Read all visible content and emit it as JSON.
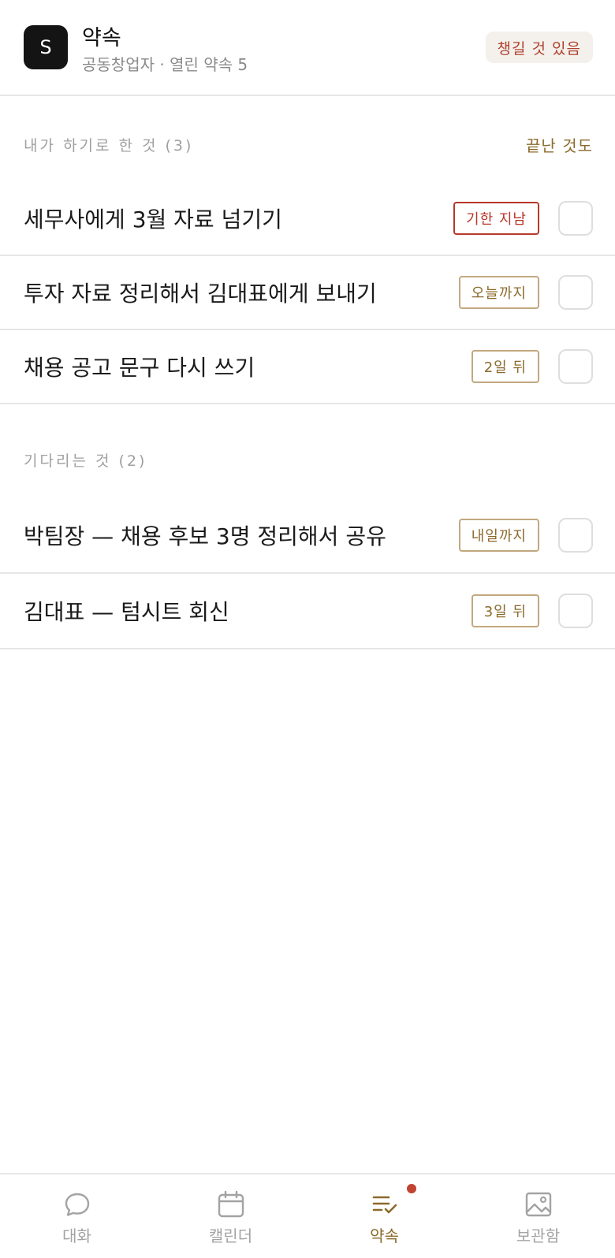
{
  "header": {
    "avatar_letter": "S",
    "title": "약속",
    "subtitle": "공동창업자 · 열린 약속 5",
    "badge": "챙길 것 있음"
  },
  "my_tasks": {
    "label": "내가 하기로 한 것 (3)",
    "action": "끝난 것도",
    "items": [
      {
        "text": "세무사에게 3월 자료 넘기기",
        "due": "기한 지남",
        "status": "overdue"
      },
      {
        "text": "투자 자료 정리해서 김대표에게 보내기",
        "due": "오늘까지",
        "status": "normal"
      },
      {
        "text": "채용 공고 문구 다시 쓰기",
        "due": "2일 뒤",
        "status": "normal"
      }
    ]
  },
  "waiting": {
    "label": "기다리는 것 (2)",
    "items": [
      {
        "text": "박팀장 — 채용 후보 3명 정리해서 공유",
        "due": "내일까지",
        "status": "normal"
      },
      {
        "text": "김대표 — 텀시트 회신",
        "due": "3일 뒤",
        "status": "normal"
      }
    ]
  },
  "nav": {
    "items": [
      {
        "label": "대화",
        "icon": "chat-bubble-icon"
      },
      {
        "label": "캘린더",
        "icon": "calendar-icon"
      },
      {
        "label": "약속",
        "icon": "checklist-icon",
        "active": true,
        "has_dot": true
      },
      {
        "label": "보관함",
        "icon": "image-icon"
      }
    ]
  },
  "colors": {
    "accent": "#8b6a2b",
    "overdue": "#b7372b",
    "dot": "#c0442f"
  }
}
